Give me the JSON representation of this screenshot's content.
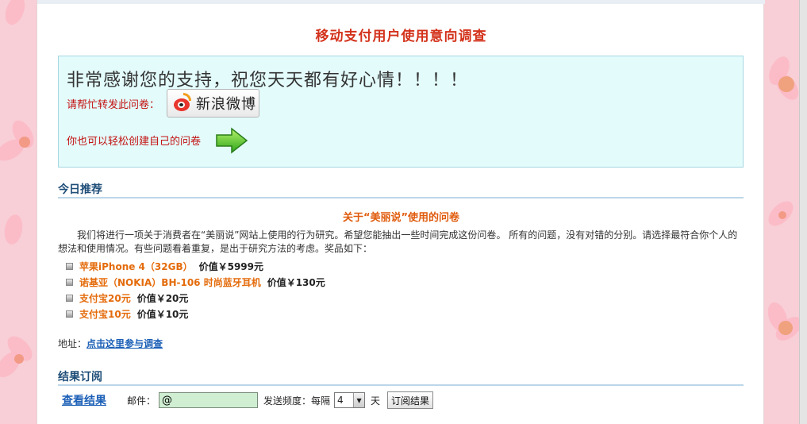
{
  "survey": {
    "title": "移动支付用户使用意向调查"
  },
  "thanks": {
    "message": "非常感谢您的支持，祝您天天都有好心情！！！！",
    "share_label": "请帮忙转发此问卷：",
    "weibo_button": "新浪微博",
    "create_label": "你也可以轻松创建自己的问卷"
  },
  "today": {
    "heading": "今日推荐",
    "title": "关于“美丽说”使用的问卷",
    "intro": "我们将进行一项关于消费者在“美丽说”网站上使用的行为研究。希望您能抽出一些时间完成这份问卷。 所有的问题，没有对错的分别。请选择最符合你个人的想法和使用情况。有些问题看着重复，是出于研究方法的考虑。奖品如下：",
    "prizes": [
      {
        "name": "苹果iPhone 4（32GB）",
        "value": "价值￥5999元"
      },
      {
        "name": "诺基亚（NOKIA）BH-106 时尚蓝牙耳机",
        "value": "价值￥130元"
      },
      {
        "name": "支付宝20元",
        "value": "价值￥20元"
      },
      {
        "name": "支付宝10元",
        "value": "价值￥10元"
      }
    ],
    "address_label": "地址：",
    "address_link": "点击这里参与调查"
  },
  "subscribe": {
    "heading": "结果订阅",
    "view_results": "查看结果",
    "email_label": "邮件：",
    "email_value": "@",
    "frequency_label": "发送频度：每隔",
    "frequency_value": "4",
    "day_label": "天",
    "submit": "订阅结果"
  },
  "colors": {
    "title_red": "#d3321b",
    "thanks_bg": "#e3fbfb",
    "section_blue": "#1e4d78",
    "prize_orange": "#e46b0b",
    "link_blue": "#1b5fb6",
    "side_pink": "#f8cfd6"
  }
}
